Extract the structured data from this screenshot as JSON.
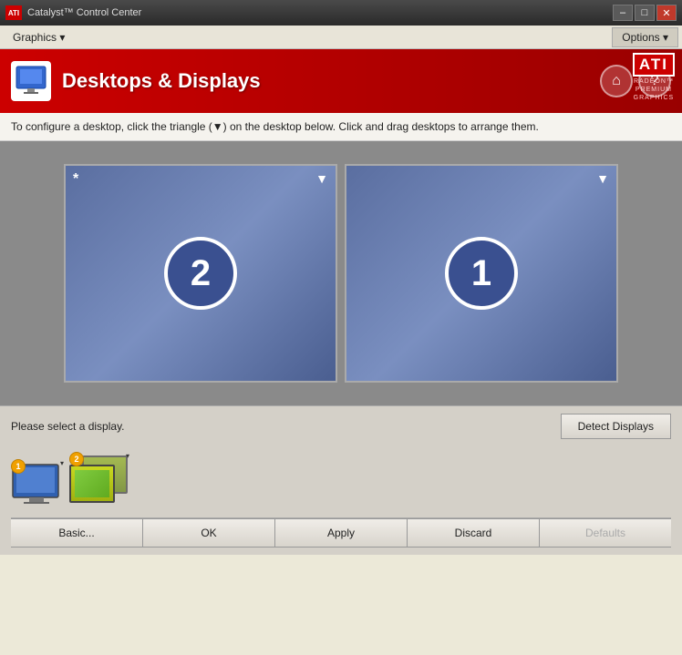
{
  "titlebar": {
    "logo": "ATI",
    "title": "Catalyst™ Control Center",
    "minimize": "–",
    "maximize": "□",
    "close": "✕"
  },
  "menubar": {
    "graphics_label": "Graphics ▾",
    "options_label": "Options ▾"
  },
  "header": {
    "title": "Desktops & Displays",
    "home_icon": "⌂",
    "help_icon": "?",
    "brand": "ATI",
    "brand_sub": "RADEON™\nPREMIUM\nGRAPHICS"
  },
  "instruction": "To configure a desktop, click the triangle (▼) on the desktop below.  Click and drag desktops to arrange them.",
  "displays": [
    {
      "id": "display-2",
      "number": "2",
      "star": "*",
      "has_dropdown": true
    },
    {
      "id": "display-1",
      "number": "1",
      "star": "",
      "has_dropdown": true
    }
  ],
  "bottom": {
    "status_text": "Please select a display.",
    "detect_button": "Detect Displays"
  },
  "thumbnails": [
    {
      "badge": "1",
      "type": "single"
    },
    {
      "badge": "2",
      "type": "double"
    }
  ],
  "buttons": {
    "basic": "Basic...",
    "ok": "OK",
    "apply": "Apply",
    "discard": "Discard",
    "defaults": "Defaults"
  }
}
